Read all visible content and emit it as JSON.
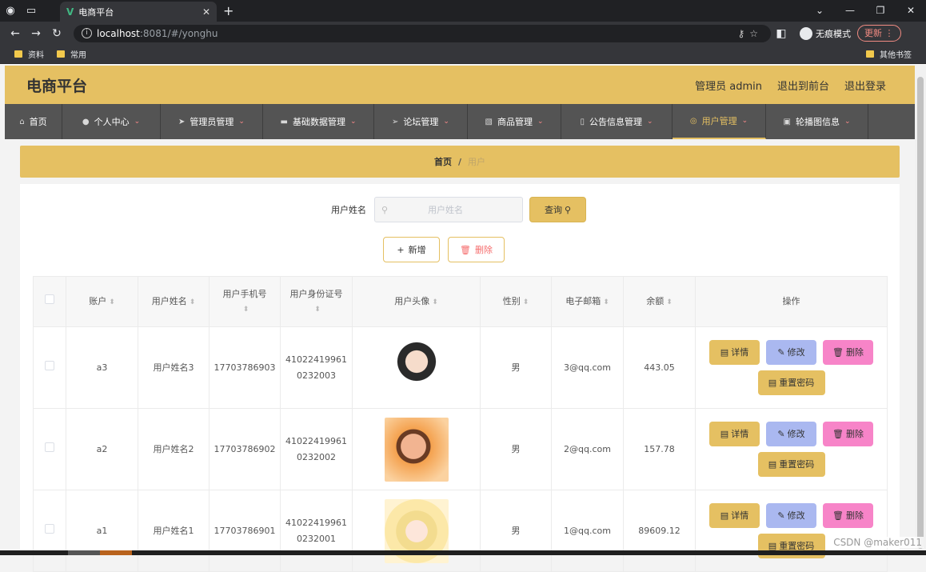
{
  "browser": {
    "tab_title": "电商平台",
    "url_host": "localhost",
    "url_path": ":8081/#/yonghu",
    "incognito_label": "无痕模式",
    "update_label": "更新",
    "bookmarks": [
      "资料",
      "常用"
    ],
    "bookmarks_right": "其他书签"
  },
  "header": {
    "title": "电商平台",
    "links": [
      "管理员 admin",
      "退出到前台",
      "退出登录"
    ]
  },
  "nav": [
    {
      "label": "首页",
      "icon": "home-icon",
      "dropdown": false
    },
    {
      "label": "个人中心",
      "icon": "user-icon",
      "dropdown": true
    },
    {
      "label": "管理员管理",
      "icon": "send-icon",
      "dropdown": true
    },
    {
      "label": "基础数据管理",
      "icon": "chat-icon",
      "dropdown": true
    },
    {
      "label": "论坛管理",
      "icon": "paper-plane-icon",
      "dropdown": true
    },
    {
      "label": "商品管理",
      "icon": "image-icon",
      "dropdown": true
    },
    {
      "label": "公告信息管理",
      "icon": "phone-icon",
      "dropdown": true
    },
    {
      "label": "用户管理",
      "icon": "compass-icon",
      "dropdown": true,
      "active": true
    },
    {
      "label": "轮播图信息",
      "icon": "box-icon",
      "dropdown": true
    }
  ],
  "breadcrumb": {
    "home": "首页",
    "separator": "/",
    "current": "用户"
  },
  "search": {
    "label": "用户姓名",
    "placeholder": "用户姓名",
    "button": "查询"
  },
  "actions": {
    "add": "新增",
    "delete": "删除"
  },
  "table": {
    "columns": [
      "账户",
      "用户姓名",
      "用户手机号",
      "用户身份证号",
      "用户头像",
      "性别",
      "电子邮箱",
      "余额",
      "操作"
    ],
    "rows": [
      {
        "account": "a3",
        "name": "用户姓名3",
        "phone": "17703786903",
        "id_line1": "41022419961",
        "id_line2": "0232003",
        "avatar": "avatar-cartoon-girl",
        "gender": "男",
        "email": "3@qq.com",
        "balance": "443.05"
      },
      {
        "account": "a2",
        "name": "用户姓名2",
        "phone": "17703786902",
        "id_line1": "41022419961",
        "id_line2": "0232002",
        "avatar": "avatar-photo-girl",
        "gender": "男",
        "email": "2@qq.com",
        "balance": "157.78"
      },
      {
        "account": "a1",
        "name": "用户姓名1",
        "phone": "17703786901",
        "id_line1": "41022419961",
        "id_line2": "0232001",
        "avatar": "avatar-anime-girl",
        "gender": "男",
        "email": "1@qq.com",
        "balance": "89609.12"
      }
    ],
    "row_actions": {
      "detail": "详情",
      "edit": "修改",
      "delete": "删除",
      "reset": "重置密码"
    }
  },
  "watermark": "CSDN @maker011",
  "colors": {
    "accent": "#e5c062",
    "nav_bg": "#545454",
    "edit": "#aab8f0",
    "delete": "#f784c8",
    "danger_text": "#f56c6c"
  }
}
